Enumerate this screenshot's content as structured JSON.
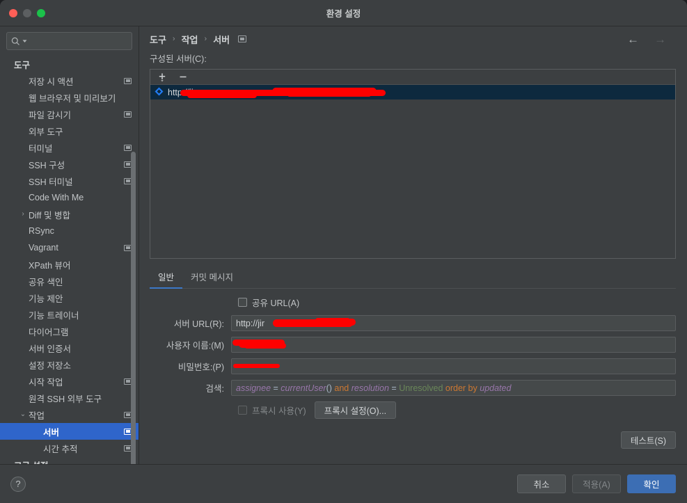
{
  "window": {
    "title": "환경 설정",
    "traffic_lights": [
      "close-red",
      "minimize-gray",
      "zoom-green"
    ]
  },
  "sidebar": {
    "search": {
      "value": "",
      "placeholder": "",
      "icon": "search-icon"
    },
    "items": [
      {
        "label": "도구",
        "level": "root",
        "has_mini_icon": false,
        "arrow": "",
        "selected": false
      },
      {
        "label": "저장 시 액션",
        "level": "lvl1",
        "has_mini_icon": true,
        "arrow": "",
        "selected": false
      },
      {
        "label": "웹 브라우저 및 미리보기",
        "level": "lvl1",
        "has_mini_icon": false,
        "arrow": "",
        "selected": false
      },
      {
        "label": "파일 감시기",
        "level": "lvl1",
        "has_mini_icon": true,
        "arrow": "",
        "selected": false
      },
      {
        "label": "외부 도구",
        "level": "lvl1",
        "has_mini_icon": false,
        "arrow": "",
        "selected": false
      },
      {
        "label": "터미널",
        "level": "lvl1",
        "has_mini_icon": true,
        "arrow": "",
        "selected": false
      },
      {
        "label": "SSH 구성",
        "level": "lvl1",
        "has_mini_icon": true,
        "arrow": "",
        "selected": false
      },
      {
        "label": "SSH 터미널",
        "level": "lvl1",
        "has_mini_icon": true,
        "arrow": "",
        "selected": false
      },
      {
        "label": "Code With Me",
        "level": "lvl1",
        "has_mini_icon": false,
        "arrow": "",
        "selected": false
      },
      {
        "label": "Diff 및 병합",
        "level": "lvl1",
        "has_mini_icon": false,
        "arrow": "›",
        "selected": false
      },
      {
        "label": "RSync",
        "level": "lvl1",
        "has_mini_icon": false,
        "arrow": "",
        "selected": false
      },
      {
        "label": "Vagrant",
        "level": "lvl1",
        "has_mini_icon": true,
        "arrow": "",
        "selected": false
      },
      {
        "label": "XPath 뷰어",
        "level": "lvl1",
        "has_mini_icon": false,
        "arrow": "",
        "selected": false
      },
      {
        "label": "공유 색인",
        "level": "lvl1",
        "has_mini_icon": false,
        "arrow": "",
        "selected": false
      },
      {
        "label": "기능 제안",
        "level": "lvl1",
        "has_mini_icon": false,
        "arrow": "",
        "selected": false
      },
      {
        "label": "기능 트레이너",
        "level": "lvl1",
        "has_mini_icon": false,
        "arrow": "",
        "selected": false
      },
      {
        "label": "다이어그램",
        "level": "lvl1",
        "has_mini_icon": false,
        "arrow": "",
        "selected": false
      },
      {
        "label": "서버 인증서",
        "level": "lvl1",
        "has_mini_icon": false,
        "arrow": "",
        "selected": false
      },
      {
        "label": "설정 저장소",
        "level": "lvl1",
        "has_mini_icon": false,
        "arrow": "",
        "selected": false
      },
      {
        "label": "시작 작업",
        "level": "lvl1",
        "has_mini_icon": true,
        "arrow": "",
        "selected": false
      },
      {
        "label": "원격 SSH 외부 도구",
        "level": "lvl1",
        "has_mini_icon": false,
        "arrow": "",
        "selected": false
      },
      {
        "label": "작업",
        "level": "lvl1",
        "has_mini_icon": true,
        "arrow": "⌄",
        "selected": false
      },
      {
        "label": "서버",
        "level": "lvl2",
        "has_mini_icon": true,
        "arrow": "",
        "selected": true
      },
      {
        "label": "시간 추적",
        "level": "lvl2",
        "has_mini_icon": true,
        "arrow": "",
        "selected": false
      },
      {
        "label": "고급 설정",
        "level": "root",
        "has_mini_icon": false,
        "arrow": "",
        "selected": false
      }
    ]
  },
  "breadcrumb": {
    "parts": [
      "도구",
      "작업",
      "서버"
    ],
    "separator": "›",
    "icon": "project-settings-icon"
  },
  "nav": {
    "back": "←",
    "forward": "→"
  },
  "main": {
    "list_caption": "구성된 서버(C):",
    "toolbar": {
      "add": "add-icon",
      "remove": "remove-icon"
    },
    "servers": [
      {
        "text": "http://ji",
        "icon": "jira-icon",
        "selected": true,
        "redacted": true
      }
    ],
    "tabs": [
      {
        "label": "일반",
        "active": true
      },
      {
        "label": "커밋 메시지",
        "active": false
      }
    ],
    "share_url": {
      "label": "공유 URL(A)",
      "checked": false
    },
    "fields": [
      {
        "label": "서버 URL(R):",
        "value": "http://jir",
        "redacted": true,
        "name": "server-url"
      },
      {
        "label": "사용자 이름:(M)",
        "value": "",
        "redacted": true,
        "name": "username"
      },
      {
        "label": "비밀번호:(P)",
        "value": "",
        "redacted": true,
        "name": "password"
      }
    ],
    "search_field": {
      "label": "검색:",
      "tokens": [
        {
          "t": "assignee",
          "c": "fld"
        },
        {
          "t": " = ",
          "c": "op"
        },
        {
          "t": "currentUser",
          "c": "fld"
        },
        {
          "t": "() ",
          "c": "op"
        },
        {
          "t": "and ",
          "c": "kw"
        },
        {
          "t": "resolution",
          "c": "fld"
        },
        {
          "t": " = ",
          "c": "op"
        },
        {
          "t": "Unresolved ",
          "c": "val"
        },
        {
          "t": "order by ",
          "c": "kw"
        },
        {
          "t": "updated",
          "c": "fld"
        }
      ]
    },
    "proxy": {
      "checkbox_label": "프록시 사용(Y)",
      "checked": false,
      "disabled": true,
      "button": "프록시 설정(O)..."
    },
    "test_button": "테스트(S)"
  },
  "footer": {
    "help": "?",
    "cancel": "취소",
    "apply": "적용(A)",
    "ok": "확인"
  },
  "colors": {
    "accent": "#3c6eb4",
    "selection": "#2f65ca",
    "row_selection": "#0d293e",
    "background": "#3c3f41",
    "redaction": "#fe0000",
    "tab_underline": "#3c78c8"
  }
}
